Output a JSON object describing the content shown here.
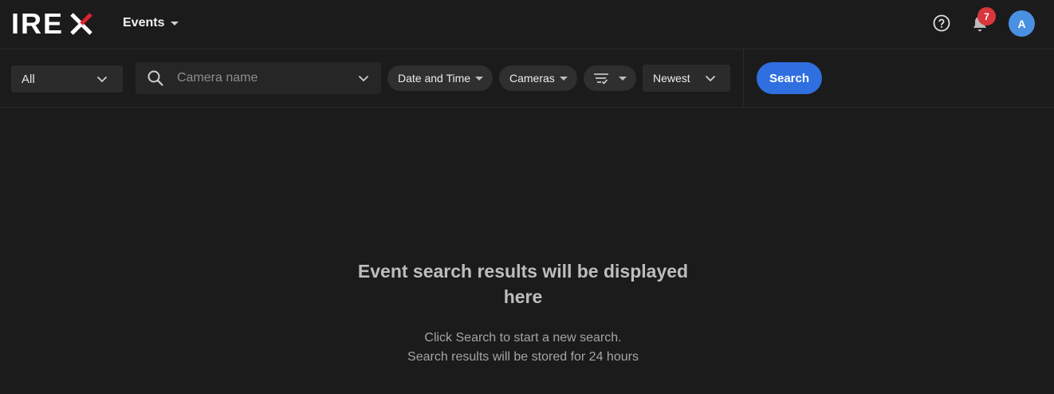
{
  "app": {
    "logo_text": "IREX",
    "brand_color": "#e2202f"
  },
  "header": {
    "section_label": "Events",
    "notification_count": "7",
    "avatar_initial": "A",
    "icons": [
      "help-icon",
      "bell-icon",
      "chevron-down-icon"
    ]
  },
  "filters": {
    "type_select": "All",
    "camera_search": {
      "placeholder": "Camera name",
      "value": ""
    },
    "date_time_label": "Date and Time",
    "cameras_label": "Cameras",
    "filter_icon": "filter-sort-icon",
    "sort_label": "Newest",
    "search_button": "Search",
    "accent_color": "#2f6fe0"
  },
  "empty_state": {
    "title_line1": "Event search results will be displayed",
    "title_line2": "here",
    "subtitle_line1": "Click Search to start a new search.",
    "subtitle_line2": "Search results will be stored for 24 hours"
  }
}
